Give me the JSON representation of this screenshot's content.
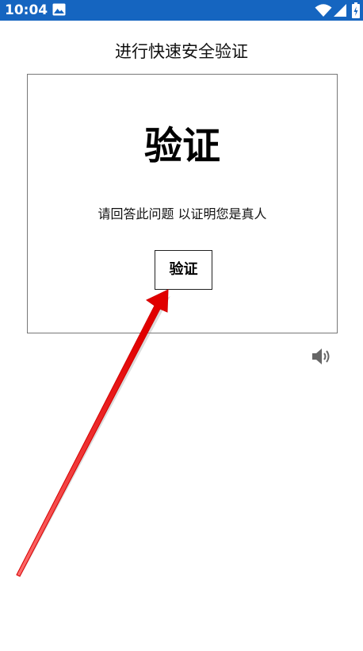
{
  "status_bar": {
    "time": "10:04",
    "background_color": "#1565c0",
    "icons": [
      "image-icon",
      "wifi-icon",
      "signal-icon",
      "battery-icon"
    ]
  },
  "page": {
    "title": "进行快速安全验证"
  },
  "challenge": {
    "heading": "验证",
    "description": "请回答此问题 以证明您是真人",
    "button_label": "验证",
    "audio_icon": "speaker-icon"
  },
  "annotation": {
    "type": "arrow",
    "color": "#ff0000",
    "points_to": "verify-button"
  }
}
